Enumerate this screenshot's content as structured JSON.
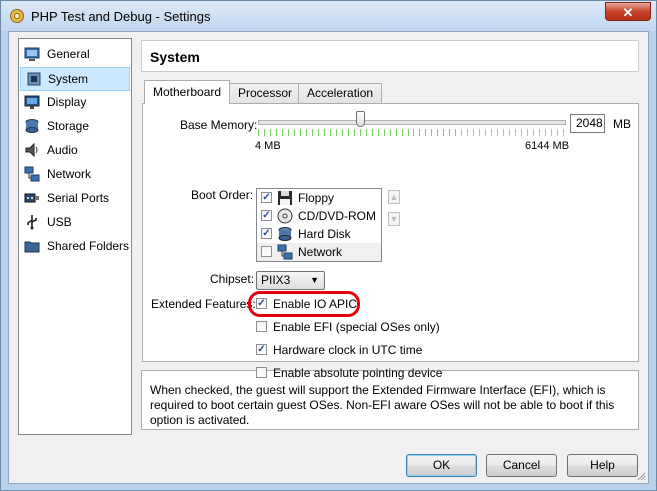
{
  "window": {
    "title": "PHP Test and Debug - Settings",
    "close_label": "✕"
  },
  "sidebar": {
    "items": [
      {
        "label": "General",
        "icon": "general-icon",
        "selected": false
      },
      {
        "label": "System",
        "icon": "system-icon",
        "selected": true
      },
      {
        "label": "Display",
        "icon": "display-icon",
        "selected": false
      },
      {
        "label": "Storage",
        "icon": "storage-icon",
        "selected": false
      },
      {
        "label": "Audio",
        "icon": "audio-icon",
        "selected": false
      },
      {
        "label": "Network",
        "icon": "network-icon",
        "selected": false
      },
      {
        "label": "Serial Ports",
        "icon": "serial-ports-icon",
        "selected": false
      },
      {
        "label": "USB",
        "icon": "usb-icon",
        "selected": false
      },
      {
        "label": "Shared Folders",
        "icon": "shared-folders-icon",
        "selected": false
      }
    ]
  },
  "page": {
    "title": "System"
  },
  "tabs": [
    {
      "label": "Motherboard",
      "active": true
    },
    {
      "label": "Processor",
      "active": false
    },
    {
      "label": "Acceleration",
      "active": false
    }
  ],
  "motherboard": {
    "base_memory": {
      "label": "Base Memory:",
      "value": "2048",
      "unit": "MB",
      "min_label": "4 MB",
      "max_label": "6144 MB",
      "fraction": 0.333
    },
    "boot_order": {
      "label": "Boot Order:",
      "devices": [
        {
          "name": "Floppy",
          "checked": true,
          "icon": "floppy-icon"
        },
        {
          "name": "CD/DVD-ROM",
          "checked": true,
          "icon": "cd-dvd-icon"
        },
        {
          "name": "Hard Disk",
          "checked": true,
          "icon": "hard-disk-icon"
        },
        {
          "name": "Network",
          "checked": false,
          "icon": "network-boot-icon"
        }
      ],
      "move_up": "▲",
      "move_down": "▼"
    },
    "chipset": {
      "label": "Chipset:",
      "value": "PIIX3",
      "arrow": "▼"
    },
    "extended_features": {
      "label": "Extended Features:",
      "options": [
        {
          "label": "Enable IO APIC",
          "checked": true
        },
        {
          "label": "Enable EFI (special OSes only)",
          "checked": false
        },
        {
          "label": "Hardware clock in UTC time",
          "checked": true
        },
        {
          "label": "Enable absolute pointing device",
          "checked": false
        }
      ]
    }
  },
  "info_text": "When checked, the guest will support the Extended Firmware Interface (EFI), which is required to boot certain guest OSes. Non-EFI aware OSes will not be able to boot if this option is activated.",
  "buttons": {
    "ok": "OK",
    "cancel": "Cancel",
    "help": "Help"
  },
  "colors": {
    "highlight": "#e8000f",
    "selected_bg": "#cce8ff",
    "slider_green": "#78d064",
    "slider_red": "#f0a8a8"
  }
}
